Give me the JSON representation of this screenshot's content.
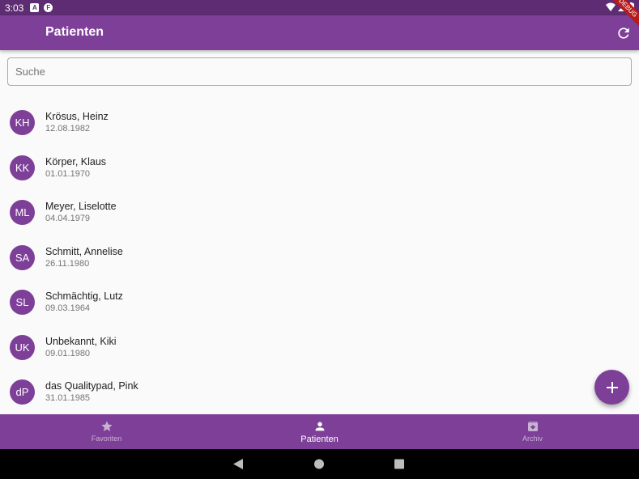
{
  "status_bar": {
    "time": "3:03",
    "debug_label": "DEBUG"
  },
  "app_bar": {
    "title": "Patienten"
  },
  "search": {
    "placeholder": "Suche"
  },
  "patients": [
    {
      "initials": "KH",
      "name": "Krösus, Heinz",
      "date": "12.08.1982"
    },
    {
      "initials": "KK",
      "name": "Körper, Klaus",
      "date": "01.01.1970"
    },
    {
      "initials": "ML",
      "name": "Meyer, Liselotte",
      "date": "04.04.1979"
    },
    {
      "initials": "SA",
      "name": "Schmitt, Annelise",
      "date": "26.11.1980"
    },
    {
      "initials": "SL",
      "name": "Schmächtig, Lutz",
      "date": "09.03.1964"
    },
    {
      "initials": "UK",
      "name": "Unbekannt, Kiki",
      "date": "09.01.1980"
    },
    {
      "initials": "dP",
      "name": "das Qualitypad, Pink",
      "date": "31.01.1985"
    }
  ],
  "bottom_nav": {
    "items": [
      {
        "label": "Favoriten",
        "icon": "star-icon"
      },
      {
        "label": "Patienten",
        "icon": "person-icon",
        "active": true
      },
      {
        "label": "Archiv",
        "icon": "archive-icon"
      }
    ]
  },
  "colors": {
    "primary": "#7d3f98",
    "status_bar": "#5e2c73",
    "background": "#fafafa"
  }
}
